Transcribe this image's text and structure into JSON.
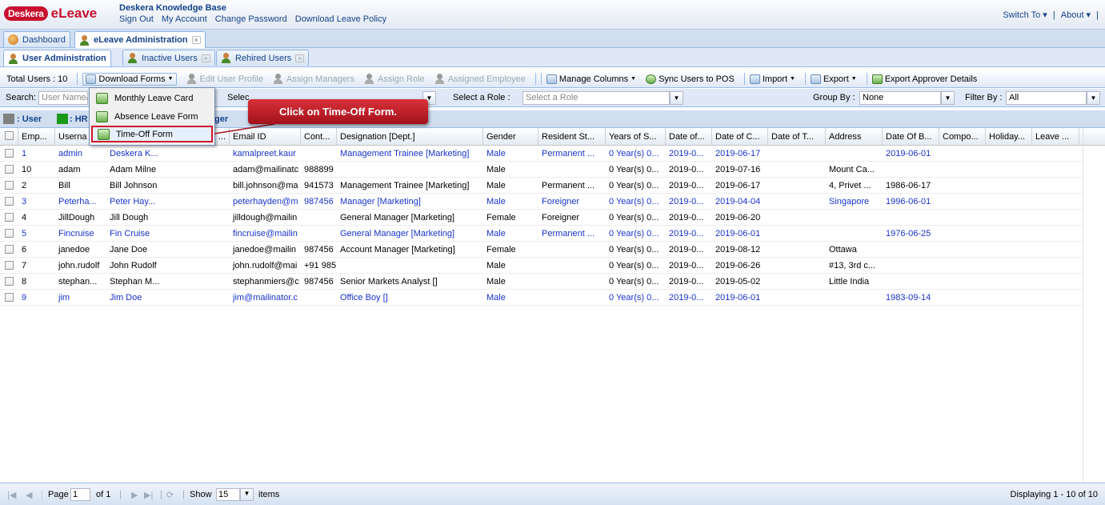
{
  "header": {
    "logo_badge": "Deskera",
    "logo_text": "eLeave",
    "kb_title": "Deskera Knowledge Base",
    "links": [
      "Sign Out",
      "My Account",
      "Change Password",
      "Download Leave Policy"
    ],
    "switch_to": "Switch To ▾",
    "about": "About ▾"
  },
  "tabs_top": [
    {
      "label": "Dashboard"
    },
    {
      "label": "eLeave Administration"
    }
  ],
  "tabs_sub": [
    {
      "label": "User Administration"
    },
    {
      "label": "Inactive Users"
    },
    {
      "label": "Rehired Users"
    }
  ],
  "toolbar": {
    "total_users": "Total Users : 10",
    "download_forms": "Download Forms",
    "edit_user_profile": "Edit User Profile",
    "assign_managers": "Assign Managers",
    "assign_role": "Assign Role",
    "assigned_employee": "Assigned Employee",
    "manage_columns": "Manage Columns",
    "sync_users": "Sync Users to POS",
    "import": "Import",
    "export": "Export",
    "export_approver": "Export Approver Details"
  },
  "search": {
    "label": "Search:",
    "placeholder": "User Name/",
    "select_label": "Selec",
    "role_label": "Select a Role :",
    "role_placeholder": "Select a Role",
    "group_label": "Group By :",
    "group_value": "None",
    "filter_label": "Filter By :",
    "filter_value": "All"
  },
  "legend": {
    "user": ": User",
    "hr": ": HR",
    "ger": "ger",
    "colors": {
      "user": "#808080",
      "hr": "#1a9a1a"
    }
  },
  "menu": {
    "items": [
      "Monthly Leave Card",
      "Absence Leave Form",
      "Time-Off Form"
    ]
  },
  "callout": {
    "text": "Click on Time-Off Form."
  },
  "columns": [
    "Emp...",
    "Userna",
    "...",
    "Email ID",
    "Cont...",
    "Designation [Dept.]",
    "Gender",
    "Resident St...",
    "Years of S...",
    "Date of...",
    "Date of C...",
    "Date of T...",
    "Address",
    "Date Of B...",
    "Compo...",
    "Holiday...",
    "Leave ..."
  ],
  "rows": [
    {
      "c": [
        "1",
        "admin",
        "Deskera K...",
        "kamalpreet.kaur",
        "",
        "Management Trainee [Marketing]",
        "Male",
        "Permanent ...",
        "0 Year(s) 0...",
        "2019-0...",
        "2019-06-17",
        "",
        "",
        "2019-06-01",
        "",
        "",
        ""
      ],
      "blue": true
    },
    {
      "c": [
        "10",
        "adam",
        "Adam Milne",
        "adam@mailinatc",
        "988899",
        "",
        "Male",
        "",
        "0 Year(s) 0...",
        "2019-0...",
        "2019-07-16",
        "",
        "Mount Ca...",
        "",
        "",
        "",
        ""
      ],
      "blue": false
    },
    {
      "c": [
        "2",
        "Bill",
        "Bill Johnson",
        "bill.johnson@ma",
        "941573",
        "Management Trainee [Marketing]",
        "Male",
        "Permanent ...",
        "0 Year(s) 0...",
        "2019-0...",
        "2019-06-17",
        "",
        "4, Privet ...",
        "1986-06-17",
        "",
        "",
        ""
      ],
      "blue": false
    },
    {
      "c": [
        "3",
        "Peterha...",
        "Peter Hay...",
        "peterhayden@m",
        "987456",
        "Manager [Marketing]",
        "Male",
        "Foreigner",
        "0 Year(s) 0...",
        "2019-0...",
        "2019-04-04",
        "",
        "Singapore",
        "1996-06-01",
        "",
        "",
        ""
      ],
      "blue": true
    },
    {
      "c": [
        "4",
        "JillDough",
        "Jill Dough",
        "jilldough@mailin",
        "",
        "General Manager [Marketing]",
        "Female",
        "Foreigner",
        "0 Year(s) 0...",
        "2019-0...",
        "2019-06-20",
        "",
        "",
        "",
        "",
        "",
        ""
      ],
      "blue": false
    },
    {
      "c": [
        "5",
        "Fincruise",
        "Fin Cruise",
        "fincruise@mailin",
        "",
        "General Manager [Marketing]",
        "Male",
        "Permanent ...",
        "0 Year(s) 0...",
        "2019-0...",
        "2019-06-01",
        "",
        "",
        "1976-06-25",
        "",
        "",
        ""
      ],
      "blue": true
    },
    {
      "c": [
        "6",
        "janedoe",
        "Jane Doe",
        "janedoe@mailin",
        "987456",
        "Account Manager [Marketing]",
        "Female",
        "",
        "0 Year(s) 0...",
        "2019-0...",
        "2019-08-12",
        "",
        "Ottawa",
        "",
        "",
        "",
        ""
      ],
      "blue": false
    },
    {
      "c": [
        "7",
        "john.rudolf",
        "John Rudolf",
        "john.rudolf@mai",
        "+91 985",
        "",
        "Male",
        "",
        "0 Year(s) 0...",
        "2019-0...",
        "2019-06-26",
        "",
        "#13, 3rd c...",
        "",
        "",
        "",
        ""
      ],
      "blue": false
    },
    {
      "c": [
        "8",
        "stephan...",
        "Stephan M...",
        "stephanmiers@c",
        "987456",
        "Senior Markets Analyst []",
        "Male",
        "",
        "0 Year(s) 0...",
        "2019-0...",
        "2019-05-02",
        "",
        "Little India",
        "",
        "",
        "",
        ""
      ],
      "blue": false
    },
    {
      "c": [
        "9",
        "jim",
        "Jim Doe",
        "jim@mailinator.c",
        "",
        "Office Boy []",
        "Male",
        "",
        "0 Year(s) 0...",
        "2019-0...",
        "2019-06-01",
        "",
        "",
        "1983-09-14",
        "",
        "",
        ""
      ],
      "blue": true
    }
  ],
  "paging": {
    "page_label": "Page",
    "page_value": "1",
    "of_label": "of 1",
    "show_label": "Show",
    "show_value": "15",
    "items_label": "items",
    "displaying": "Displaying 1 - 10 of 10"
  }
}
